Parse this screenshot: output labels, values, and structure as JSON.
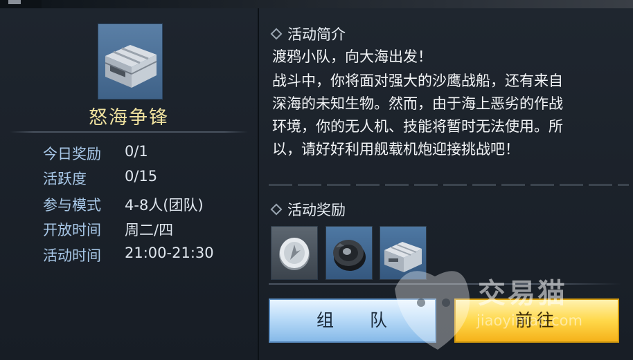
{
  "activity": {
    "name": "怒海争锋",
    "info": [
      {
        "label": "今日奖励",
        "value": "0/1"
      },
      {
        "label": "活跃度",
        "value": "0/15"
      },
      {
        "label": "参与模式",
        "value": "4-8人(团队)"
      },
      {
        "label": "开放时间",
        "value": "周二/四"
      },
      {
        "label": "活动时间",
        "value": "21:00-21:30"
      }
    ]
  },
  "description": {
    "title": "活动简介",
    "lines": [
      "渡鸦小队，向大海出发！",
      "战斗中，你将面对强大的沙鹰战船，还有来自",
      "深海的未知生物。然而，由于海上恶劣的作战",
      "环境，你的无人机、技能将暂时无法使用。所",
      "以，请好好利用舰载机炮迎接挑战吧！"
    ]
  },
  "rewards": {
    "title": "活动奖励",
    "items": [
      {
        "icon": "silver-coin-icon"
      },
      {
        "icon": "gear-part-icon"
      },
      {
        "icon": "supply-crate-icon"
      }
    ]
  },
  "buttons": {
    "team": "组 队",
    "goto": "前往"
  },
  "watermark": {
    "text": "交易猫",
    "url": "jiaoyimao.com"
  },
  "colors": {
    "title_gold": "#f1e3a0",
    "label_blue": "#a8c8e8",
    "team_button": "#b9dbf8",
    "goto_button": "#ffd84a"
  }
}
